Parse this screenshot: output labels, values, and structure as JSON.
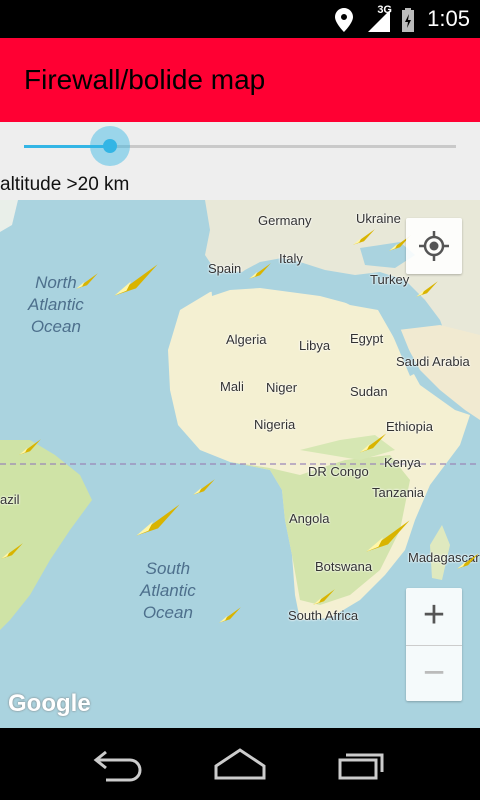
{
  "status_bar": {
    "network": "3G",
    "time": "1:05"
  },
  "app_bar": {
    "title": "Firewall/bolide map"
  },
  "slider": {
    "label": "altitude >20 km",
    "value_fraction": 0.2
  },
  "map": {
    "countries": [
      "Germany",
      "Ukraine",
      "Italy",
      "Spain",
      "Turkey",
      "Algeria",
      "Libya",
      "Egypt",
      "Saudi Arabia",
      "Mali",
      "Niger",
      "Sudan",
      "Nigeria",
      "Ethiopia",
      "DR Congo",
      "Kenya",
      "Tanzania",
      "Angola",
      "Botswana",
      "South Africa",
      "Madagascar",
      "azil"
    ],
    "oceans": [
      [
        "North",
        "Atlantic",
        "Ocean"
      ],
      [
        "South",
        "Atlantic",
        "Ocean"
      ]
    ],
    "logo": "Google",
    "zoom_in_symbol": "+",
    "zoom_out_symbol": "−"
  }
}
